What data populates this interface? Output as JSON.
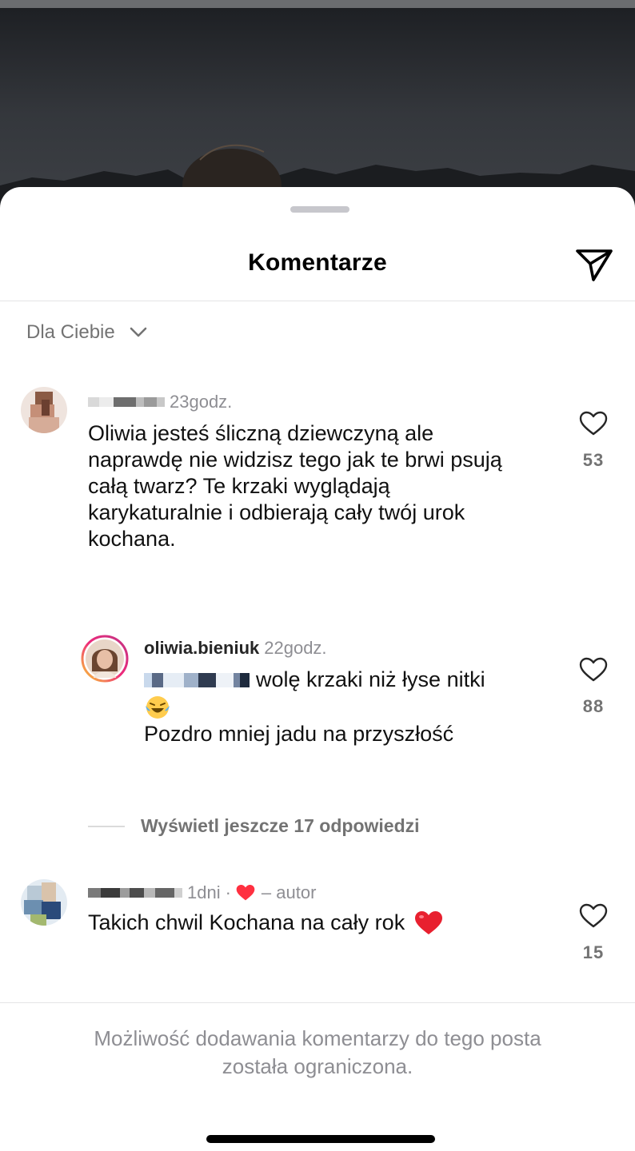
{
  "sheet": {
    "title": "Komentarze",
    "filter_label": "Dla Ciebie"
  },
  "comments": [
    {
      "time": "23godz.",
      "text_lines": [
        "Oliwia jesteś śliczną dziewczyną ale",
        "naprawdę nie widzisz tego jak te brwi psują",
        "całą twarz? Te krzaki wyglądają",
        "karykaturalnie i odbierają cały twój urok",
        "kochana."
      ],
      "likes": "53"
    },
    {
      "username": "oliwia.bieniuk",
      "time": "22godz.",
      "text_line1": "wolę krzaki niż łyse nitki",
      "text_line3": "Pozdro mniej jadu na przyszłość",
      "likes": "88"
    },
    {
      "time": "1dni",
      "separator": "·",
      "author_suffix": "– autor",
      "text": "Takich chwil Kochana na cały rok",
      "emoji": "❤️",
      "likes": "15"
    }
  ],
  "view_more_replies": "Wyświetl jeszcze 17 odpowiedzi",
  "restricted_notice": {
    "line1": "Możliwość dodawania komentarzy do tego posta",
    "line2": "została ograniczona."
  },
  "colors": {
    "heart_red": "#ff3040",
    "story_ring_start": "#f9ce34",
    "story_ring_end": "#ee2a7b",
    "muted_text": "#737373"
  },
  "icons": {
    "share": "paper-plane-icon",
    "filter_toggle": "chevron-down-icon",
    "like": "heart-outline-icon"
  }
}
